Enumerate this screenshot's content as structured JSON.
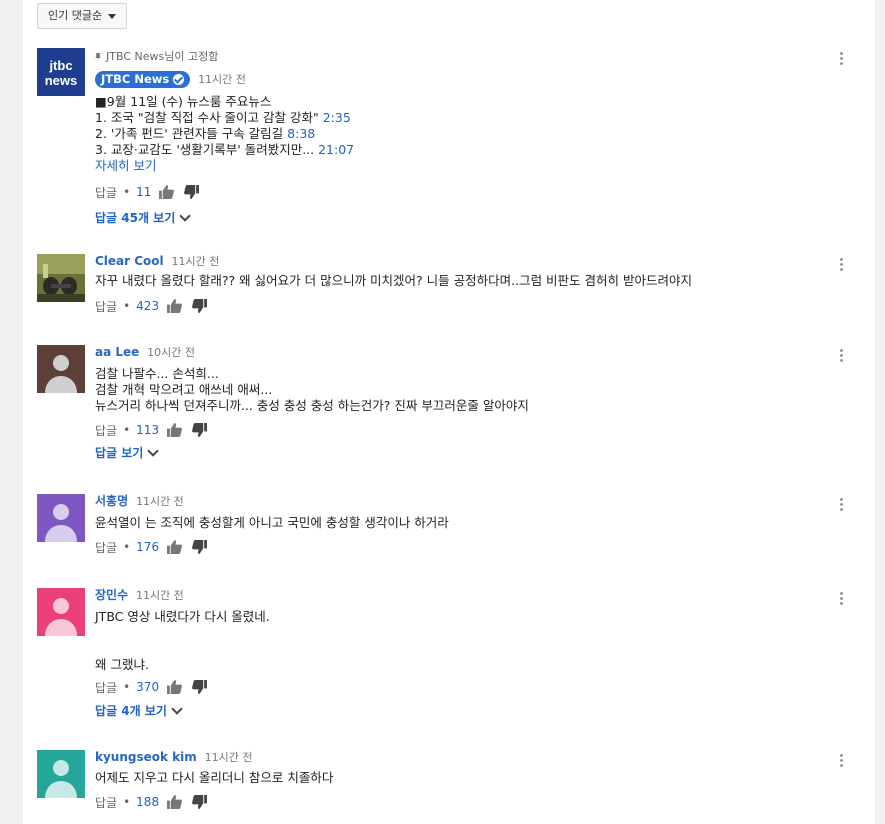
{
  "sort": {
    "label": "인기 댓글순"
  },
  "pinned_comment": {
    "pinned_label": "JTBC News님이 고정함",
    "channel_badge": "JTBC News",
    "time": "11시간 전",
    "lines": [
      {
        "text": "■9월 11일 (수) 뉴스룸 주요뉴스",
        "ts": ""
      },
      {
        "text": "1. 조국 \"검찰 직접 수사 줄이고 감찰 강화\"",
        "ts": "2:35"
      },
      {
        "text": "2. '가족 펀드' 관련자들 구속 갈림길",
        "ts": "8:38"
      },
      {
        "text": "3. 교장·교감도 '생활기록부' 돌려봤지만...",
        "ts": "21:07"
      }
    ],
    "read_more": "자세히 보기",
    "reply_label": "답글",
    "likes": "11",
    "view_replies": "답글 45개 보기",
    "avatar_text": {
      "top": "jtbc",
      "bottom": "news"
    },
    "avatar_color": "#1e3d8f"
  },
  "comments": [
    {
      "author": "Clear Cool",
      "time": "11시간 전",
      "lines": [
        "자꾸 내렸다 올렸다 할래?? 왜 싫어요가 더 많으니까 미치겠어? 니들 공정하다며..그럼 비판도 겸허히 받아드려야지"
      ],
      "reply_label": "답글",
      "likes": "423",
      "view_replies": ""
    },
    {
      "author": "aa Lee",
      "time": "10시간 전",
      "lines": [
        "검찰 나팔수...  손석희...",
        "검찰 개혁 막으려고 애쓰네 애써...",
        "뉴스거리 하나씩 던져주니까... 충성 충성 충성 하는건가?   진짜 부끄러운줄 알아야지"
      ],
      "reply_label": "답글",
      "likes": "113",
      "view_replies": "답글 보기",
      "avatar_color": "#5d4037"
    },
    {
      "author": "서홍명",
      "time": "11시간 전",
      "lines": [
        "윤석열이 는  조직에 충성할게 아니고  국민에 충성할 생각이나 하거라"
      ],
      "reply_label": "답글",
      "likes": "176",
      "view_replies": "",
      "avatar_color": "#7e57c2"
    },
    {
      "author": "장민수",
      "time": "11시간 전",
      "lines": [
        "JTBC 영상 내렸다가 다시 올렸네.",
        "",
        "",
        "왜 그랬냐."
      ],
      "reply_label": "답글",
      "likes": "370",
      "view_replies": "답글 4개 보기",
      "avatar_color": "#ec407a"
    },
    {
      "author": "kyungseok kim",
      "time": "11시간 전",
      "lines": [
        "어제도 지우고 다시 올리더니 참으로 치졸하다"
      ],
      "reply_label": "답글",
      "likes": "188",
      "view_replies": "",
      "avatar_color": "#26a69a"
    }
  ]
}
